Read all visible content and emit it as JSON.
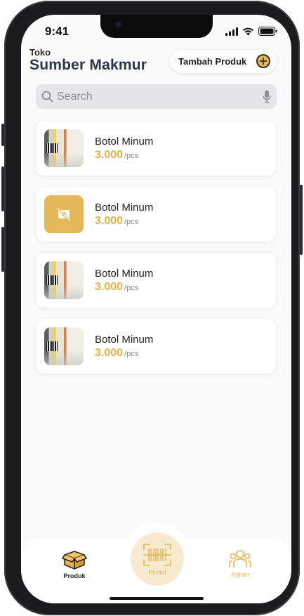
{
  "status_bar": {
    "time": "9:41"
  },
  "header": {
    "subtitle": "Toko",
    "title": "Sumber Makmur",
    "add_button_label": "Tambah Produk"
  },
  "search": {
    "placeholder": "Search"
  },
  "products": [
    {
      "name": "Botol Minum",
      "price": "3.000",
      "unit": "/pcs",
      "image": "photo"
    },
    {
      "name": "Botol Minum",
      "price": "3.000",
      "unit": "/pcs",
      "image": "no-image-icon"
    },
    {
      "name": "Botol Minum",
      "price": "3.000",
      "unit": "/pcs",
      "image": "photo"
    },
    {
      "name": "Botol Minum",
      "price": "3.000",
      "unit": "/pcs",
      "image": "photo"
    }
  ],
  "bottom_nav": {
    "items": [
      {
        "label": "Produk",
        "icon": "box-icon",
        "active": true
      },
      {
        "label": "Pindai",
        "icon": "barcode-scan-icon",
        "active": false
      },
      {
        "label": "Admin",
        "icon": "users-icon",
        "active": false
      }
    ]
  },
  "colors": {
    "accent": "#e3b95b",
    "price": "#e0b24f",
    "title": "#2e3548",
    "background": "#fafafa"
  }
}
